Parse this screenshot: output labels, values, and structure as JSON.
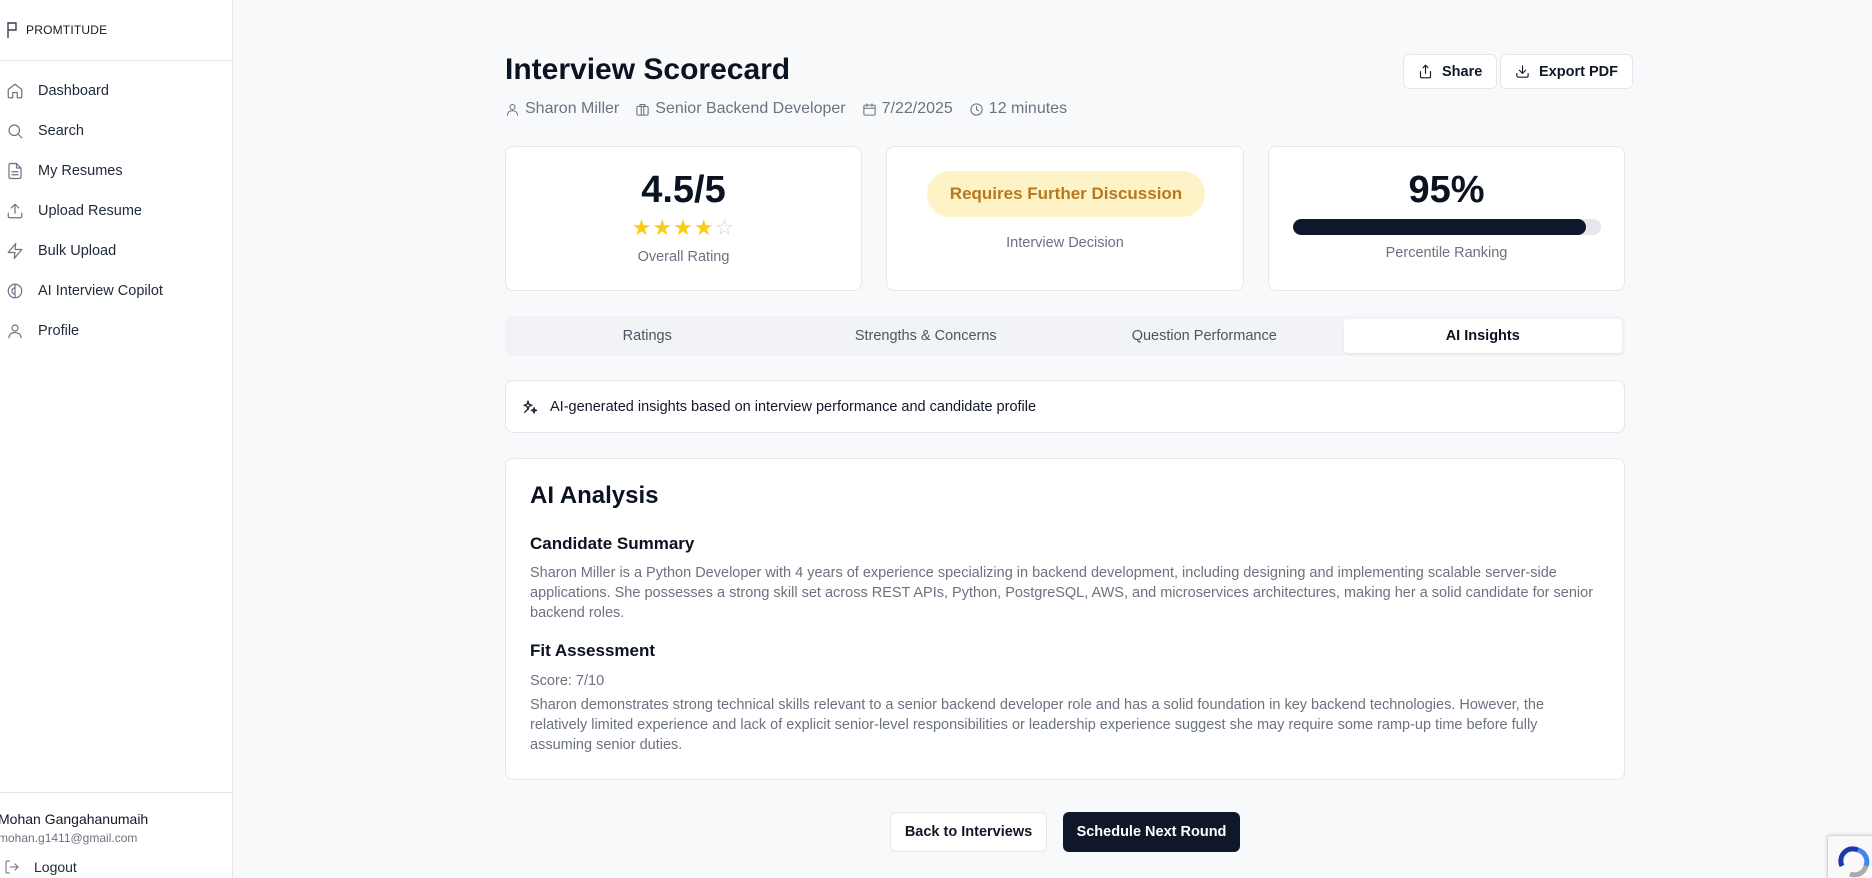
{
  "sidebar": {
    "brand": "PROMTITUDE",
    "items": [
      {
        "label": "Dashboard",
        "icon": "home-icon"
      },
      {
        "label": "Search",
        "icon": "search-icon"
      },
      {
        "label": "My Resumes",
        "icon": "file-text-icon"
      },
      {
        "label": "Upload Resume",
        "icon": "upload-icon"
      },
      {
        "label": "Bulk Upload",
        "icon": "lightning-icon"
      },
      {
        "label": "AI Interview Copilot",
        "icon": "brain-icon"
      },
      {
        "label": "Profile",
        "icon": "user-icon"
      }
    ],
    "user": {
      "name": "Mohan Gangahanumaih",
      "email": "mohan.g1411@gmail.com"
    },
    "logout_label": "Logout"
  },
  "header": {
    "title": "Interview Scorecard",
    "candidate": "Sharon Miller",
    "role": "Senior Backend Developer",
    "date": "7/22/2025",
    "duration": "12 minutes",
    "share_label": "Share",
    "export_label": "Export PDF"
  },
  "summary": {
    "rating": {
      "value": "4.5/5",
      "stars_filled": 4,
      "stars_total": 5,
      "caption": "Overall Rating"
    },
    "decision": {
      "value": "Requires Further Discussion",
      "caption": "Interview Decision"
    },
    "percentile": {
      "value": "95%",
      "fraction": 0.95,
      "caption": "Percentile Ranking"
    }
  },
  "tabs": [
    {
      "label": "Ratings",
      "active": false
    },
    {
      "label": "Strengths & Concerns",
      "active": false
    },
    {
      "label": "Question Performance",
      "active": false
    },
    {
      "label": "AI Insights",
      "active": true
    }
  ],
  "insights_banner": "AI-generated insights based on interview performance and candidate profile",
  "analysis": {
    "title": "AI Analysis",
    "summary_title": "Candidate Summary",
    "summary_text": "Sharon Miller is a Python Developer with 4 years of experience specializing in backend development, including designing and implementing scalable server-side applications. She possesses a strong skill set across REST APIs, Python, PostgreSQL, AWS, and microservices architectures, making her a solid candidate for senior backend roles.",
    "fit_title": "Fit Assessment",
    "fit_score": "Score: 7/10",
    "fit_text": "Sharon demonstrates strong technical skills relevant to a senior backend developer role and has a solid foundation in key backend technologies. However, the relatively limited experience and lack of explicit senior-level responsibilities or leadership experience suggest she may require some ramp-up time before fully assuming senior duties."
  },
  "actions": {
    "back_label": "Back to Interviews",
    "next_label": "Schedule Next Round"
  },
  "colors": {
    "primary": "#0f172a",
    "star": "#facc15",
    "decision_bg": "#fef3c7",
    "decision_text": "#b7791f"
  }
}
